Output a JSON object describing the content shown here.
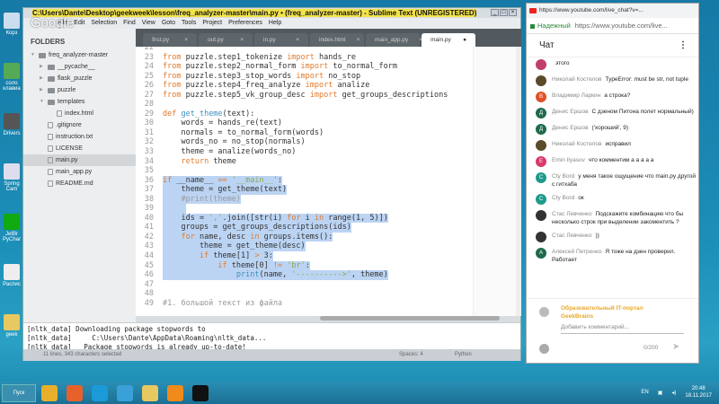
{
  "desktop": {
    "icons": [
      {
        "label": "Корз"
      },
      {
        "label": "сoло клавиа"
      },
      {
        "label": "Drivers"
      },
      {
        "label": "Spring Cam"
      },
      {
        "label": "JetBr PyChar"
      },
      {
        "label": "Распис"
      },
      {
        "label": "geek"
      }
    ]
  },
  "sublime": {
    "title": "C:\\Users\\Dante\\Desktop\\geekweek\\lesson\\freq_analyzer-master\\main.py • (freq_analyzer-master) - Sublime Text (UNREGISTERED)",
    "menu": [
      "File",
      "Edit",
      "Selection",
      "Find",
      "View",
      "Goto",
      "Tools",
      "Project",
      "Preferences",
      "Help"
    ],
    "overlay_logo": "Google",
    "sidebar": {
      "header": "FOLDERS",
      "items": [
        {
          "label": "freq_analyzer-master",
          "depth": 0,
          "type": "folder-open"
        },
        {
          "label": "__pycache__",
          "depth": 1,
          "type": "folder"
        },
        {
          "label": "flask_puzzle",
          "depth": 1,
          "type": "folder"
        },
        {
          "label": "puzzle",
          "depth": 1,
          "type": "folder"
        },
        {
          "label": "templates",
          "depth": 1,
          "type": "folder-open"
        },
        {
          "label": "index.html",
          "depth": 2,
          "type": "file"
        },
        {
          "label": ".gitignore",
          "depth": 1,
          "type": "file"
        },
        {
          "label": "instruction.txt",
          "depth": 1,
          "type": "file"
        },
        {
          "label": "LICENSE",
          "depth": 1,
          "type": "file"
        },
        {
          "label": "main.py",
          "depth": 1,
          "type": "file",
          "selected": true
        },
        {
          "label": "main_app.py",
          "depth": 1,
          "type": "file"
        },
        {
          "label": "README.md",
          "depth": 1,
          "type": "file"
        }
      ]
    },
    "tabs": [
      {
        "label": "first.py",
        "close": "×"
      },
      {
        "label": "out.py",
        "close": "×"
      },
      {
        "label": "in.py",
        "close": "×"
      },
      {
        "label": "index.html",
        "close": "×"
      },
      {
        "label": "main_app.py",
        "close": "×"
      },
      {
        "label": "main.py",
        "close": "●",
        "active": true
      }
    ],
    "code": [
      {
        "n": "22",
        "t": []
      },
      {
        "n": "23",
        "t": [
          [
            "kw",
            "from"
          ],
          [
            "pl",
            " puzzle.step1_tokenize "
          ],
          [
            "kw",
            "import"
          ],
          [
            "pl",
            " hands_re"
          ]
        ]
      },
      {
        "n": "24",
        "t": [
          [
            "kw",
            "from"
          ],
          [
            "pl",
            " puzzle.step2_normal_form "
          ],
          [
            "kw",
            "import"
          ],
          [
            "pl",
            " to_normal_form"
          ]
        ]
      },
      {
        "n": "25",
        "t": [
          [
            "kw",
            "from"
          ],
          [
            "pl",
            " puzzle.step3_stop_words "
          ],
          [
            "kw",
            "import"
          ],
          [
            "pl",
            " no_stop"
          ]
        ]
      },
      {
        "n": "26",
        "t": [
          [
            "kw",
            "from"
          ],
          [
            "pl",
            " puzzle.step4_freq_analyze "
          ],
          [
            "kw",
            "import"
          ],
          [
            "pl",
            " analize"
          ]
        ]
      },
      {
        "n": "27",
        "t": [
          [
            "kw",
            "from"
          ],
          [
            "pl",
            " puzzle.step5_vk_group_desc "
          ],
          [
            "kw",
            "import"
          ],
          [
            "pl",
            " get_groups_descriptions"
          ]
        ]
      },
      {
        "n": "28",
        "t": []
      },
      {
        "n": "29",
        "t": [
          [
            "kw",
            "def"
          ],
          [
            "pl",
            " "
          ],
          [
            "fn",
            "get_theme"
          ],
          [
            "pl",
            "(text):"
          ]
        ]
      },
      {
        "n": "30",
        "t": [
          [
            "pl",
            "    words = hands_re(text)"
          ]
        ]
      },
      {
        "n": "31",
        "t": [
          [
            "pl",
            "    normals = to_normal_form(words)"
          ]
        ]
      },
      {
        "n": "32",
        "t": [
          [
            "pl",
            "    words_no = no_stop(normals)"
          ]
        ]
      },
      {
        "n": "33",
        "t": [
          [
            "pl",
            "    theme = analize(words_no)"
          ]
        ]
      },
      {
        "n": "34",
        "t": [
          [
            "pl",
            "    "
          ],
          [
            "kw",
            "return"
          ],
          [
            "pl",
            " theme"
          ]
        ]
      },
      {
        "n": "35",
        "t": []
      },
      {
        "n": "36",
        "s": true,
        "t": [
          [
            "kw",
            "if"
          ],
          [
            "pl",
            " __name__ "
          ],
          [
            "kw",
            "=="
          ],
          [
            "pl",
            " "
          ],
          [
            "str",
            "'__main__'"
          ],
          [
            "pl",
            ":"
          ]
        ]
      },
      {
        "n": "37",
        "s": true,
        "t": [
          [
            "pl",
            "    theme = get_theme(text)"
          ]
        ]
      },
      {
        "n": "38",
        "s": true,
        "t": [
          [
            "cm",
            "    #print(theme)"
          ]
        ]
      },
      {
        "n": "39",
        "s": true,
        "t": [
          [
            "pl",
            "     "
          ]
        ]
      },
      {
        "n": "40",
        "s": true,
        "t": [
          [
            "pl",
            "    ids = "
          ],
          [
            "str",
            "','"
          ],
          [
            "pl",
            ".join([str(i) "
          ],
          [
            "kw",
            "for"
          ],
          [
            "pl",
            " i "
          ],
          [
            "kw",
            "in"
          ],
          [
            "pl",
            " range(1, 5)])"
          ]
        ]
      },
      {
        "n": "41",
        "s": true,
        "t": [
          [
            "pl",
            "    groups = get_groups_descriptions(ids)"
          ]
        ]
      },
      {
        "n": "42",
        "s": true,
        "t": [
          [
            "pl",
            "    "
          ],
          [
            "kw",
            "for"
          ],
          [
            "pl",
            " name, desc "
          ],
          [
            "kw",
            "in"
          ],
          [
            "pl",
            " groups.items():"
          ]
        ]
      },
      {
        "n": "43",
        "s": true,
        "t": [
          [
            "pl",
            "        theme = get_theme(desc)"
          ]
        ]
      },
      {
        "n": "44",
        "s": true,
        "t": [
          [
            "pl",
            "        "
          ],
          [
            "kw",
            "if"
          ],
          [
            "pl",
            " theme[1] "
          ],
          [
            "kw",
            ">"
          ],
          [
            "pl",
            " 3:"
          ]
        ]
      },
      {
        "n": "45",
        "s": true,
        "t": [
          [
            "pl",
            "            "
          ],
          [
            "kw",
            "if"
          ],
          [
            "pl",
            " theme[0] "
          ],
          [
            "kw",
            "!="
          ],
          [
            "pl",
            " "
          ],
          [
            "str",
            "'br'"
          ],
          [
            "pl",
            ":"
          ]
        ]
      },
      {
        "n": "46",
        "s": true,
        "t": [
          [
            "pl",
            "                "
          ],
          [
            "fn",
            "print"
          ],
          [
            "pl",
            "(name, "
          ],
          [
            "str",
            "'---------->'"
          ],
          [
            "pl",
            ", theme)"
          ]
        ]
      },
      {
        "n": "47",
        "t": []
      },
      {
        "n": "48",
        "t": []
      },
      {
        "n": "49",
        "t": [
          [
            "cm",
            "#1. большой текст из файла"
          ]
        ]
      }
    ],
    "console": [
      "[nltk_data] Downloading package stopwords to",
      "[nltk_data]     C:\\Users\\Dante\\AppData\\Roaming\\nltk_data...",
      "[nltk_data]   Package stopwords is already up-to-date!"
    ],
    "status": {
      "selection": "11 lines, 343 characters selected",
      "spaces": "Spaces: 4",
      "syntax": "Python"
    }
  },
  "chrome": {
    "title": "https://www.youtube.com/live_chat?v=...",
    "secure": "Надежный",
    "url": "https://www.youtube.com/live...",
    "chat_title": "Чат",
    "menu_icon": "⋮",
    "messages": [
      {
        "author": "",
        "text": "этого",
        "letter": "",
        "color": "#c0406a"
      },
      {
        "author": "Николай Костелов",
        "text": "TypeError: must be str, not tuple",
        "letter": "",
        "color": "#5a4a2a"
      },
      {
        "author": "Владимир Ларкин",
        "text": "а строка?",
        "letter": "В",
        "color": "#e0502a"
      },
      {
        "author": "Денис Ершов",
        "text": "С дзеном Питона полет нормальный)",
        "letter": "Д",
        "color": "#1e6a4a"
      },
      {
        "author": "Денис Ершов",
        "text": "('хороший', 9)",
        "letter": "Д",
        "color": "#1e6a4a"
      },
      {
        "author": "Николай Костелов",
        "text": "исправил",
        "letter": "",
        "color": "#5a4a2a"
      },
      {
        "author": "Emin Ilyasov",
        "text": "что комментим а а а а а",
        "letter": "E",
        "color": "#d83a6a"
      },
      {
        "author": "Cty Bord",
        "text": "у меня такое ощущение что main.py другой с гитхаба",
        "letter": "C",
        "color": "#1f9a8a"
      },
      {
        "author": "Cty Bord",
        "text": "ок",
        "letter": "C",
        "color": "#1f9a8a"
      },
      {
        "author": "Стас Левченко",
        "text": "Подскажите комбинацию что бы несколько строк при выделении закоментить ?",
        "letter": "",
        "color": "#333"
      },
      {
        "author": "Стас Левченко",
        "text": "))",
        "letter": "",
        "color": "#333"
      },
      {
        "author": "Алексей Петренко",
        "text": "Я тоже на дзен проверил. Работает",
        "letter": "А",
        "color": "#1e6a4a"
      }
    ],
    "channel": "Образовательный IT-портал GeekBrains",
    "input_placeholder": "Добавить комментарий...",
    "counter": "0/200",
    "send_icon": "➤"
  },
  "taskbar": {
    "start": "Пуск",
    "lang": "EN",
    "time": "20:48",
    "date": "18.11.2017",
    "apps": [
      {
        "name": "chrome",
        "color": "#e8b02a"
      },
      {
        "name": "firefox",
        "color": "#e8602a"
      },
      {
        "name": "skype",
        "color": "#1a9ad8"
      },
      {
        "name": "telegram",
        "color": "#3aa0d8"
      },
      {
        "name": "explorer",
        "color": "#e8c860"
      },
      {
        "name": "sublime",
        "color": "#f08a1a"
      },
      {
        "name": "cmd",
        "color": "#111"
      }
    ]
  }
}
